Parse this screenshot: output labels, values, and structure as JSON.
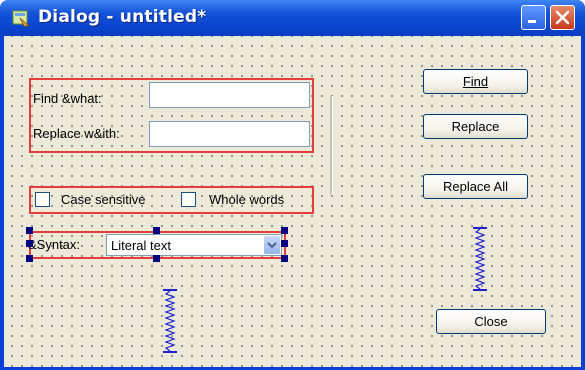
{
  "window": {
    "title": "Dialog - untitled*"
  },
  "find_label": "Find &what:",
  "replace_label": "Replace w&ith:",
  "find_value": "",
  "replace_value": "",
  "case_sensitive": {
    "label": "Case sensitive",
    "checked": false
  },
  "whole_words": {
    "label": "Whole words",
    "checked": false
  },
  "syntax_label": "&Syntax:",
  "syntax_selected": "Literal text",
  "buttons": {
    "find": "Find",
    "replace": "Replace",
    "replace_all": "Replace All",
    "close": "Close"
  },
  "icons": {
    "app": "dialog-app-icon",
    "minimize": "minimize-icon",
    "close": "close-icon",
    "dropdown": "chevron-down-icon",
    "spacer": "vertical-spacer-icon"
  },
  "colors": {
    "title_bar": "#0a43cf",
    "client_bg": "#ece9d8",
    "selection_frame": "#e23c3c",
    "handle": "#000080",
    "spacer": "#2020d0"
  }
}
